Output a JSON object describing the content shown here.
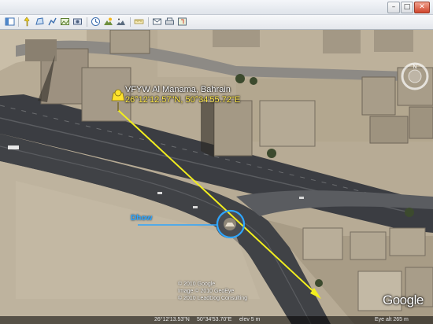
{
  "toolbar": {
    "icons": [
      "sidebar-icon",
      "placemark-icon",
      "polygon-icon",
      "path-icon",
      "image-overlay-icon",
      "tour-icon",
      "historical-imagery-icon",
      "sunlight-icon",
      "sky-icon",
      "ruler-icon",
      "email-icon",
      "print-icon",
      "google-maps-icon"
    ]
  },
  "placemark": {
    "name": "VFYW Al Manama, Bahrain",
    "coords": "26°12'12.57\"N,  50°34'55.72\"E"
  },
  "annotation": {
    "label": "Dhow"
  },
  "credits": {
    "line1": "© 2010 Google",
    "line2": "Image © 2010 GeoEye",
    "line3": "© 2010 LeadDog Consulting"
  },
  "logo": "Google",
  "status": {
    "pointer": "26°12'13.53\"N",
    "pointer_lon": "50°34'53.70\"E",
    "elev": "elev   5 m",
    "eye_alt": "Eye alt   265 m"
  },
  "colors": {
    "line": "#f2ee1e",
    "annotation": "#2ea6ff",
    "pin": "#ffe22d"
  }
}
